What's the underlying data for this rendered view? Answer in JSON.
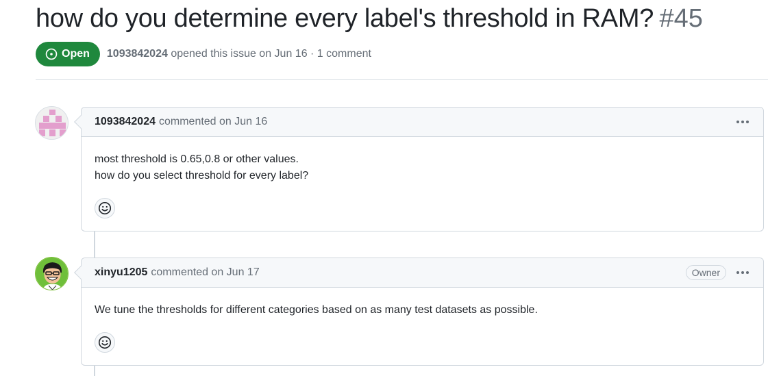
{
  "issue": {
    "title": "how do you determine every label's threshold in RAM?",
    "number": "#45",
    "state": "Open",
    "author": "1093842024",
    "opened_text": "opened this issue on Jun 16 · 1 comment"
  },
  "comments": [
    {
      "author": "1093842024",
      "action": "commented on Jun 16",
      "body": [
        "most threshold is 0.65,0.8 or other values.",
        "how do you select threshold for every label?"
      ]
    },
    {
      "author": "xinyu1205",
      "action": "commented on Jun 17",
      "badge": "Owner",
      "body": [
        "We tune the thresholds for different categories based on as many test datasets as possible."
      ]
    }
  ],
  "icons": {
    "state": "issue-opened-icon",
    "menu": "kebab-horizontal-icon",
    "reaction": "smiley-icon"
  },
  "colors": {
    "open_green": "#1f883d",
    "identicon_pink": "#e39fcd"
  }
}
